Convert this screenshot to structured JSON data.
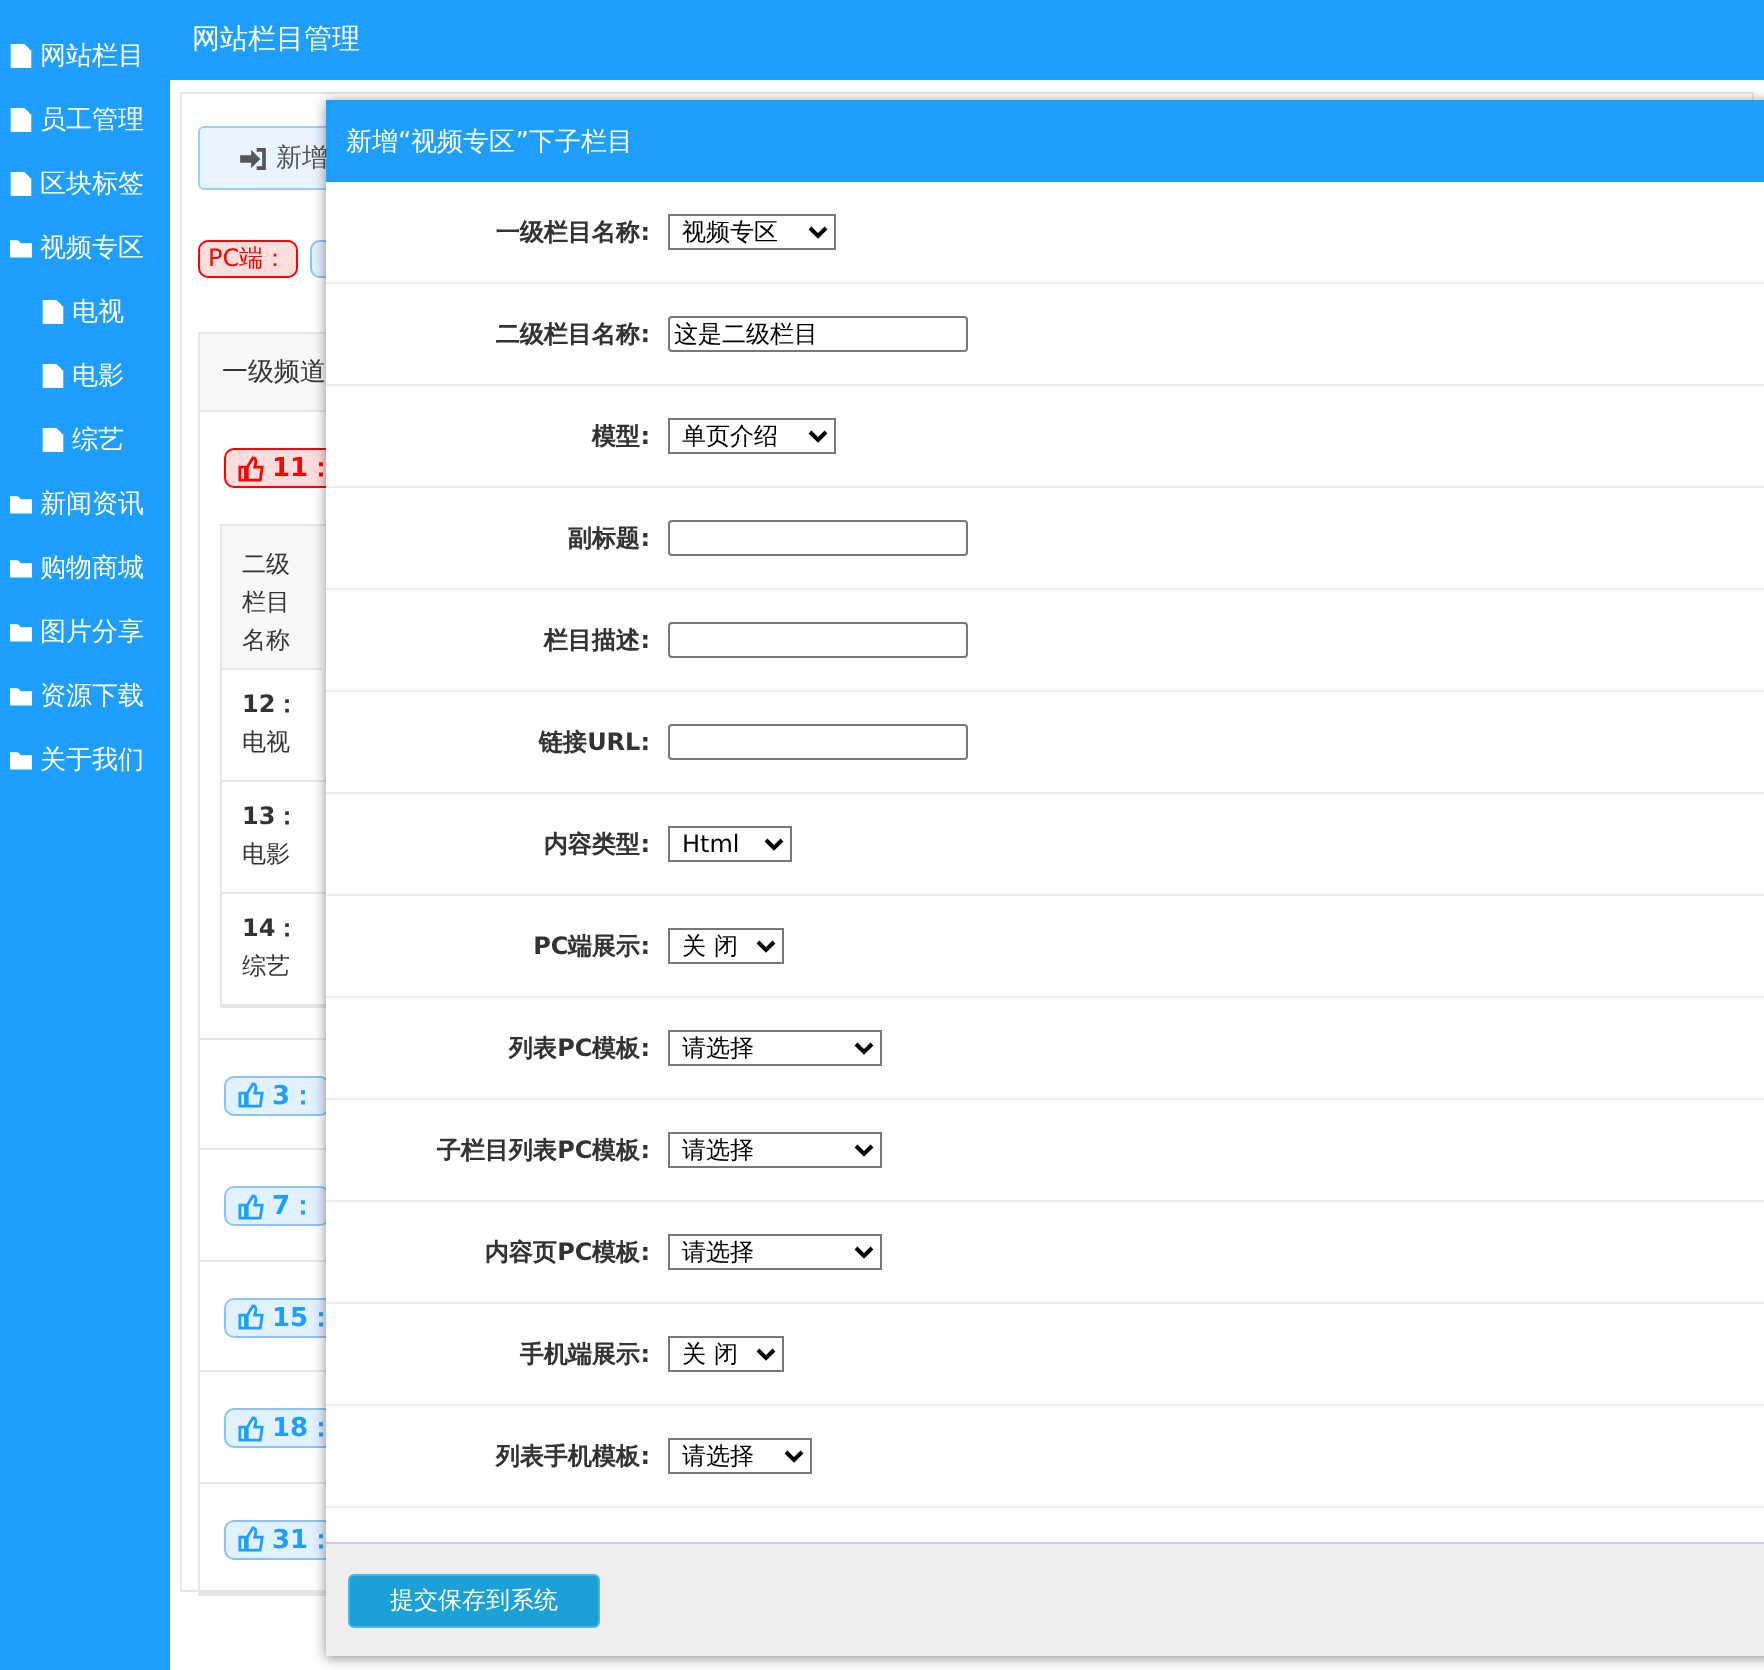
{
  "sidebar": {
    "items": [
      {
        "label": "网站栏目",
        "kind": "file"
      },
      {
        "label": "员工管理",
        "kind": "file"
      },
      {
        "label": "区块标签",
        "kind": "file"
      },
      {
        "label": "视频专区",
        "kind": "folder",
        "children": [
          {
            "label": "电视",
            "kind": "file"
          },
          {
            "label": "电影",
            "kind": "file"
          },
          {
            "label": "综艺",
            "kind": "file"
          }
        ]
      },
      {
        "label": "新闻资讯",
        "kind": "folder"
      },
      {
        "label": "购物商城",
        "kind": "folder"
      },
      {
        "label": "图片分享",
        "kind": "folder"
      },
      {
        "label": "资源下载",
        "kind": "folder"
      },
      {
        "label": "关于我们",
        "kind": "folder"
      }
    ]
  },
  "main": {
    "title": "网站栏目管理",
    "add_button": "新增",
    "platform_tag": "PC端：",
    "table": {
      "header": "一级频道",
      "channels": [
        {
          "id": "11：",
          "selected": true,
          "sub_table": {
            "header": "二级栏目名称",
            "rows": [
              {
                "id": "12：",
                "name": "电视"
              },
              {
                "id": "13：",
                "name": "电影"
              },
              {
                "id": "14：",
                "name": "综艺"
              }
            ]
          }
        },
        {
          "id": "3：",
          "selected": false
        },
        {
          "id": "7：",
          "selected": false
        },
        {
          "id": "15：",
          "selected": false
        },
        {
          "id": "18：",
          "selected": false
        },
        {
          "id": "31：",
          "selected": false
        }
      ]
    }
  },
  "dialog": {
    "title": "新增“视频专区”下子栏目",
    "fields": [
      {
        "label": "一级栏目名称:",
        "kind": "select",
        "value": "视频专区"
      },
      {
        "label": "二级栏目名称:",
        "kind": "input",
        "value": "这是二级栏目"
      },
      {
        "label": "模型:",
        "kind": "select",
        "value": "单页介绍"
      },
      {
        "label": "副标题:",
        "kind": "input"
      },
      {
        "label": "栏目描述:",
        "kind": "input"
      },
      {
        "label": "链接URL:",
        "kind": "input"
      },
      {
        "label": "内容类型:",
        "kind": "select",
        "value": "Html"
      },
      {
        "label": "PC端展示:",
        "kind": "select",
        "value": "关 闭"
      },
      {
        "label": "列表PC模板:",
        "kind": "select",
        "value": "请选择"
      },
      {
        "label": "子栏目列表PC模板:",
        "kind": "select",
        "value": "请选择"
      },
      {
        "label": "内容页PC模板:",
        "kind": "select",
        "value": "请选择"
      },
      {
        "label": "手机端展示:",
        "kind": "select",
        "value": "关 闭"
      },
      {
        "label": "列表手机模板:",
        "kind": "select",
        "value": "请选择"
      }
    ],
    "submit": "提交保存到系统"
  }
}
